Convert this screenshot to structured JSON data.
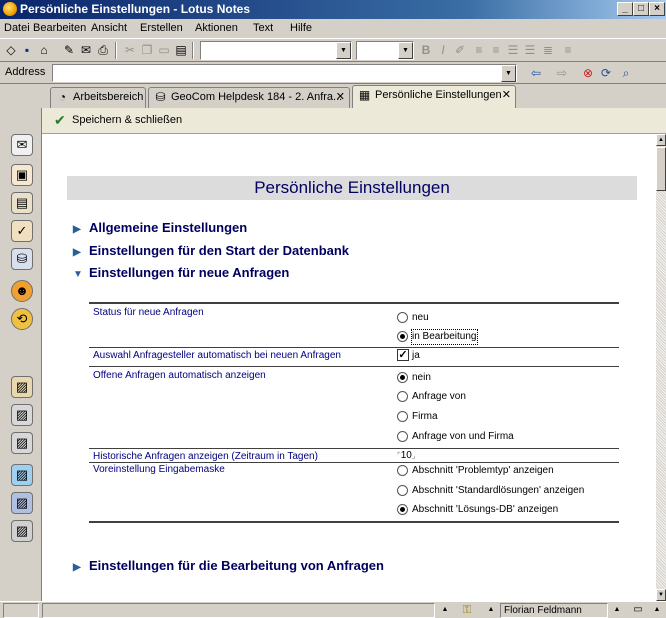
{
  "window": {
    "title": "Persönliche Einstellungen - Lotus Notes",
    "minimize": "_",
    "maximize": "□",
    "close": "×"
  },
  "menu": [
    "Datei",
    "Bearbeiten",
    "Ansicht",
    "Erstellen",
    "Aktionen",
    "Text",
    "Hilfe"
  ],
  "address": {
    "label": "Address",
    "value": ""
  },
  "tabs": [
    {
      "label": "Arbeitsbereich",
      "icon": "workspace-icon"
    },
    {
      "label": "GeoCom Helpdesk 184 - 2. Anfra...",
      "icon": "database-icon"
    },
    {
      "label": "Persönliche Einstellungen",
      "icon": "settings-doc-icon",
      "active": true
    }
  ],
  "actions": {
    "save_close": "Speichern & schließen"
  },
  "page": {
    "title": "Persönliche Einstellungen",
    "sections": {
      "general": "Allgemeine Einstellungen",
      "startup": "Einstellungen für den Start der Datenbank",
      "new_requests": "Einstellungen für neue Anfragen",
      "editing": "Einstellungen für die Bearbeitung von Anfragen"
    },
    "fields": {
      "status_label": "Status für neue Anfragen",
      "status_options": [
        "neu",
        "in Bearbeitung"
      ],
      "status_selected": "in Bearbeitung",
      "auto_requester_label": "Auswahl Anfragesteller automatisch bei neuen Anfragen",
      "auto_requester_value": "ja",
      "auto_requester_checked": true,
      "open_requests_label": "Offene Anfragen automatisch anzeigen",
      "open_requests_options": [
        "nein",
        "Anfrage von",
        "Firma",
        "Anfrage von und Firma"
      ],
      "open_requests_selected": "nein",
      "history_label": "Historische Anfragen anzeigen (Zeitraum in Tagen)",
      "history_value": "10",
      "mask_label": "Voreinstellung Eingabemaske",
      "mask_options": [
        "Abschnitt 'Problemtyp' anzeigen",
        "Abschnitt 'Standardlösungen' anzeigen",
        "Abschnitt 'Lösungs-DB' anzeigen"
      ],
      "mask_selected": "Abschnitt 'Lösungs-DB' anzeigen"
    }
  },
  "status": {
    "user": "Florian Feldmann"
  }
}
